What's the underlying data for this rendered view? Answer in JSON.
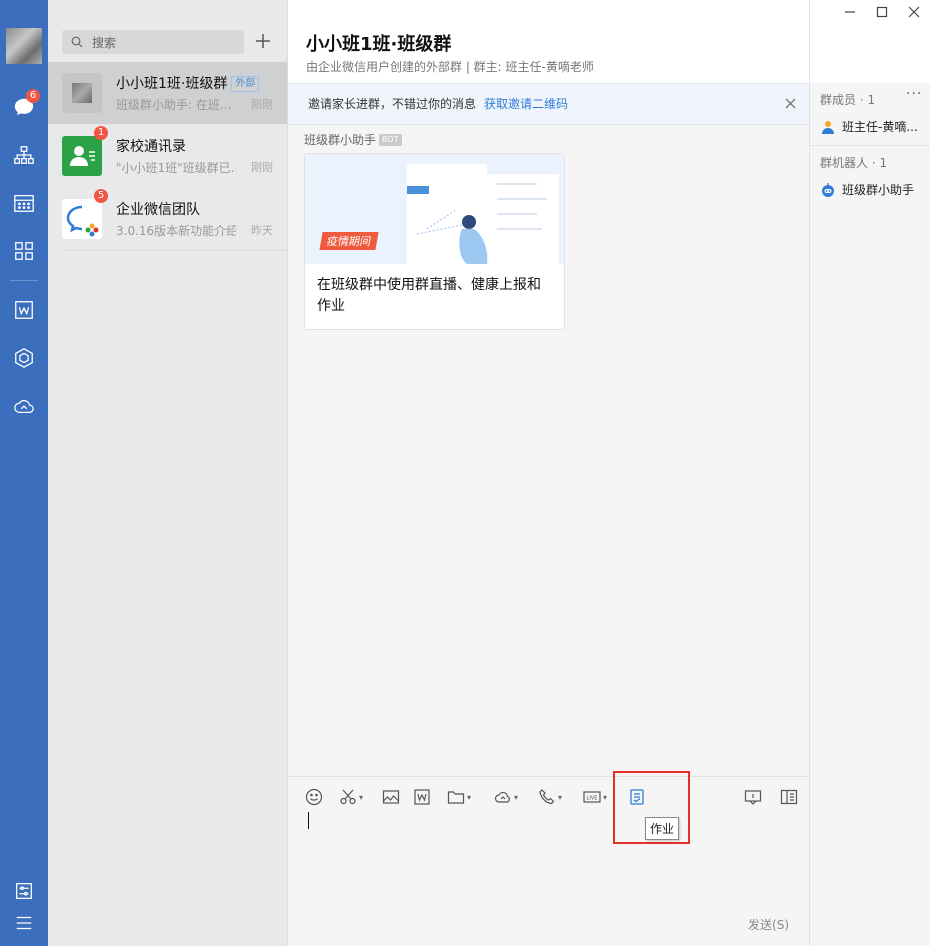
{
  "nav": {
    "chat_badge": "6",
    "items": [
      "chat-icon",
      "org-icon",
      "calendar-icon",
      "apps-icon",
      "doc-icon",
      "cube-icon",
      "cloud-icon"
    ],
    "bottom": [
      "settings-icon",
      "menu-icon"
    ]
  },
  "search": {
    "placeholder": "搜索"
  },
  "conversations": [
    {
      "title": "小小班1班·班级群",
      "tag": "外部",
      "sub": "班级群小助手: 在班...",
      "time": "刚刚"
    },
    {
      "title": "家校通讯录",
      "badge": "1",
      "sub": "\"小小班1班\"班级群已...",
      "time": "刚刚"
    },
    {
      "title": "企业微信团队",
      "badge": "5",
      "sub": "3.0.16版本新功能介绍",
      "time": "昨天"
    }
  ],
  "chat": {
    "title": "小小班1班·班级群",
    "subtitle": "由企业微信用户创建的外部群 | 群主: 班主任-黄嘀老师",
    "invite_text": "邀请家长进群，不错过你的消息",
    "invite_link": "获取邀请二维码",
    "sender": "班级群小助手",
    "sender_tag": "BOT",
    "card_badge": "疫情期间",
    "card_text": "在班级群中使用群直播、健康上报和作业",
    "tooltip": "作业",
    "send_label": "发送(S)"
  },
  "side": {
    "members_label": "群成员 · 1",
    "member": "班主任-黄嘀...",
    "robots_label": "群机器人 · 1",
    "robot": "班级群小助手"
  },
  "colors": {
    "nav_bg": "#3b6ebd",
    "accent": "#2f7bd8",
    "badge": "#f25544",
    "highlight": "#e4302b"
  }
}
